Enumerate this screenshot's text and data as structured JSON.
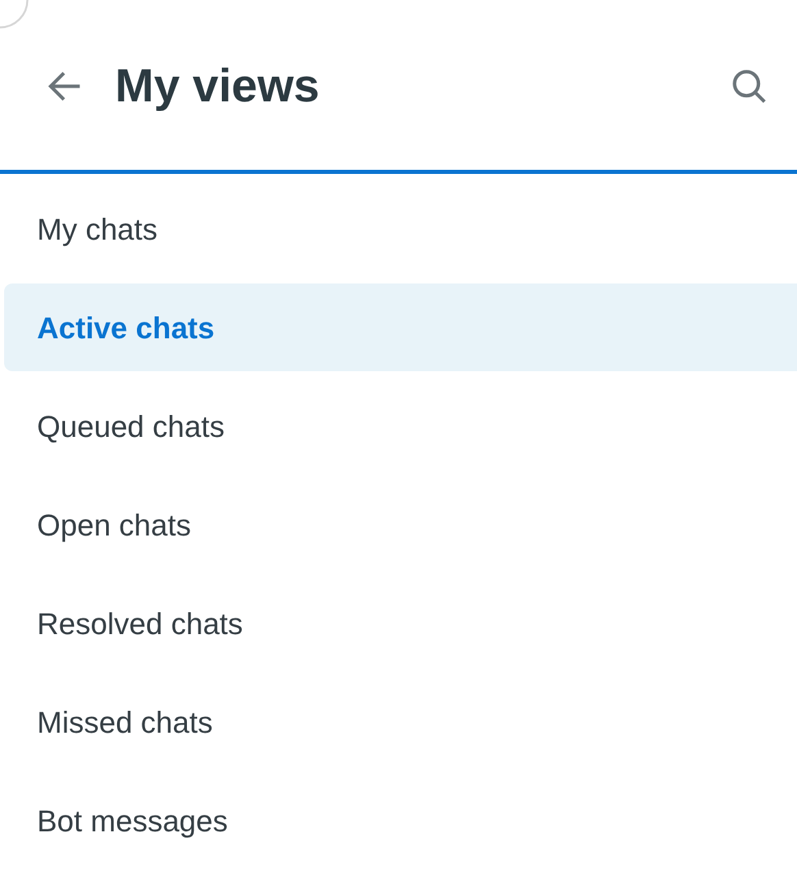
{
  "header": {
    "title": "My views"
  },
  "views": [
    {
      "label": "My chats",
      "selected": false
    },
    {
      "label": "Active chats",
      "selected": true
    },
    {
      "label": "Queued chats",
      "selected": false
    },
    {
      "label": "Open chats",
      "selected": false
    },
    {
      "label": "Resolved chats",
      "selected": false
    },
    {
      "label": "Missed chats",
      "selected": false
    },
    {
      "label": "Bot messages",
      "selected": false
    }
  ]
}
